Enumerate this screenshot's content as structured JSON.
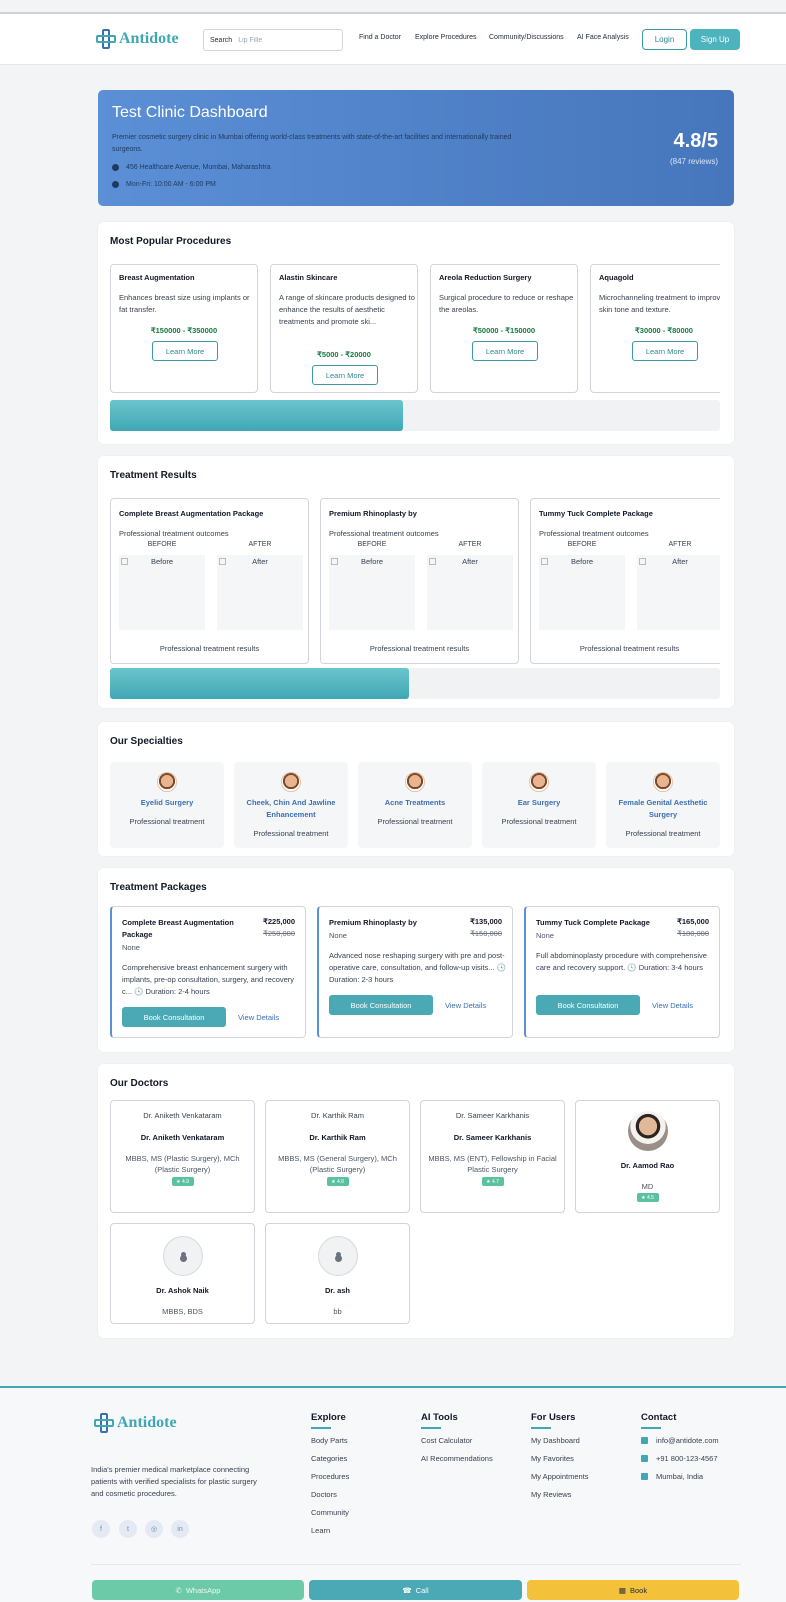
{
  "brand": {
    "name": "Antidote",
    "primary": "#3fa8b4",
    "secondary": "#3c6fb2"
  },
  "header": {
    "search_label": "Search",
    "search_placeholder": "Lip Fille",
    "nav": [
      "Find a Doctor",
      "Explore Procedures",
      "Community/Discussions",
      "AI Face Analysis"
    ],
    "login": "Login",
    "signup": "Sign Up"
  },
  "hero": {
    "title": "Test Clinic Dashboard",
    "description": "Premier cosmetic surgery clinic in Mumbai offering world-class treatments with state-of-the-art facilities and internationally trained surgeons.",
    "address": "456 Healthcare Avenue, Mumbai, Maharashtra",
    "hours": "Mon-Fri: 10:00 AM - 6:00 PM",
    "rating": "4.8/5",
    "reviews": "(847 reviews)"
  },
  "procedures": {
    "title": "Most Popular Procedures",
    "scroll_fraction": 0.48,
    "items": [
      {
        "name": "Breast Augmentation",
        "desc": "Enhances breast size using implants or fat transfer.",
        "price": "₹150000 - ₹350000",
        "cta": "Learn More"
      },
      {
        "name": "Alastin Skincare",
        "desc": "A range of skincare products designed to enhance the results of aesthetic treatments and promote ski...",
        "price": "₹5000 - ₹20000",
        "cta": "Learn More"
      },
      {
        "name": "Areola Reduction Surgery",
        "desc": "Surgical procedure to reduce or reshape the areolas.",
        "price": "₹50000 - ₹150000",
        "cta": "Learn More"
      },
      {
        "name": "Aquagold",
        "desc": "Microchanneling treatment to improve skin tone and texture.",
        "price": "₹30000 - ₹80000",
        "cta": "Learn More"
      }
    ]
  },
  "results": {
    "title": "Treatment Results",
    "scroll_fraction": 0.49,
    "before_label": "BEFORE",
    "after_label": "AFTER",
    "before_alt": "Before",
    "after_alt": "After",
    "items": [
      {
        "name": "Complete Breast Augmentation Package",
        "subtitle": "Professional treatment outcomes",
        "footer": "Professional treatment results"
      },
      {
        "name": "Premium Rhinoplasty by",
        "subtitle": "Professional treatment outcomes",
        "footer": "Professional treatment results"
      },
      {
        "name": "Tummy Tuck Complete Package",
        "subtitle": "Professional treatment outcomes",
        "footer": "Professional treatment results"
      }
    ]
  },
  "specialties": {
    "title": "Our Specialties",
    "items": [
      {
        "name": "Eyelid Surgery",
        "sub": "Professional treatment"
      },
      {
        "name": "Cheek, Chin And Jawline Enhancement",
        "sub": "Professional treatment"
      },
      {
        "name": "Acne Treatments",
        "sub": "Professional treatment"
      },
      {
        "name": "Ear Surgery",
        "sub": "Professional treatment"
      },
      {
        "name": "Female Genital Aesthetic Surgery",
        "sub": "Professional treatment"
      }
    ]
  },
  "packages": {
    "title": "Treatment Packages",
    "items": [
      {
        "name": "Complete Breast Augmentation Package",
        "price": "₹225,000",
        "old_price": "₹250,000",
        "note": "None",
        "desc": "Comprehensive breast enhancement surgery with implants, pre-op consultation, surgery, and recovery c...",
        "duration": "Duration: 2-4 hours",
        "book": "Book Consultation",
        "view": "View Details"
      },
      {
        "name": "Premium Rhinoplasty by",
        "price": "₹135,000",
        "old_price": "₹150,000",
        "note": "None",
        "desc": "Advanced nose reshaping surgery with pre and post-operative care, consultation, and follow-up visits...",
        "duration": "Duration: 2-3 hours",
        "book": "Book Consultation",
        "view": "View Details"
      },
      {
        "name": "Tummy Tuck Complete Package",
        "price": "₹165,000",
        "old_price": "₹180,000",
        "note": "None",
        "desc": "Full abdominoplasty procedure with comprehensive care and recovery support.",
        "duration": "Duration: 3-4 hours",
        "book": "Book Consultation",
        "view": "View Details"
      }
    ]
  },
  "doctors": {
    "title": "Our Doctors",
    "items": [
      {
        "alt": "Dr. Aniketh Venkataram",
        "name": "Dr. Aniketh Venkataram",
        "qual": "MBBS, MS (Plastic Surgery), MCh (Plastic Surgery)",
        "rating": "★ 4.9"
      },
      {
        "alt": "Dr. Karthik Ram",
        "name": "Dr. Karthik Ram",
        "qual": "MBBS, MS (General Surgery), MCh (Plastic Surgery)",
        "rating": "★ 4.8"
      },
      {
        "alt": "Dr. Sameer Karkhanis",
        "name": "Dr. Sameer Karkhanis",
        "qual": "MBBS, MS (ENT), Fellowship in Facial Plastic Surgery",
        "rating": "★ 4.7"
      },
      {
        "name": "Dr. Aamod Rao",
        "qual": "MD",
        "rating": "★ 4.5"
      },
      {
        "name": "Dr. Ashok Naik",
        "qual": "MBBS, BDS"
      },
      {
        "name": "Dr. ash",
        "qual": "bb"
      }
    ]
  },
  "footer": {
    "tagline": "India's premier medical marketplace connecting patients with verified specialists for plastic surgery and cosmetic procedures.",
    "social": [
      "f",
      "t",
      "◎",
      "in"
    ],
    "columns": [
      {
        "title": "Explore",
        "links": [
          "Body Parts",
          "Categories",
          "Procedures",
          "Doctors",
          "Community",
          "Learn"
        ]
      },
      {
        "title": "AI Tools",
        "links": [
          "Cost Calculator",
          "AI Recommendations"
        ]
      },
      {
        "title": "For Users",
        "links": [
          "My Dashboard",
          "My Favorites",
          "My Appointments",
          "My Reviews"
        ]
      },
      {
        "title": "Contact",
        "links": [
          "info@antidote.com",
          "+91 800-123-4567",
          "Mumbai, India"
        ]
      }
    ]
  },
  "bottom_bar": {
    "whatsapp": "WhatsApp",
    "call": "Call",
    "book": "Book",
    "colors": {
      "whatsapp": "#6ccaa8",
      "call": "#4aa9b4",
      "book": "#f3c13a"
    }
  }
}
